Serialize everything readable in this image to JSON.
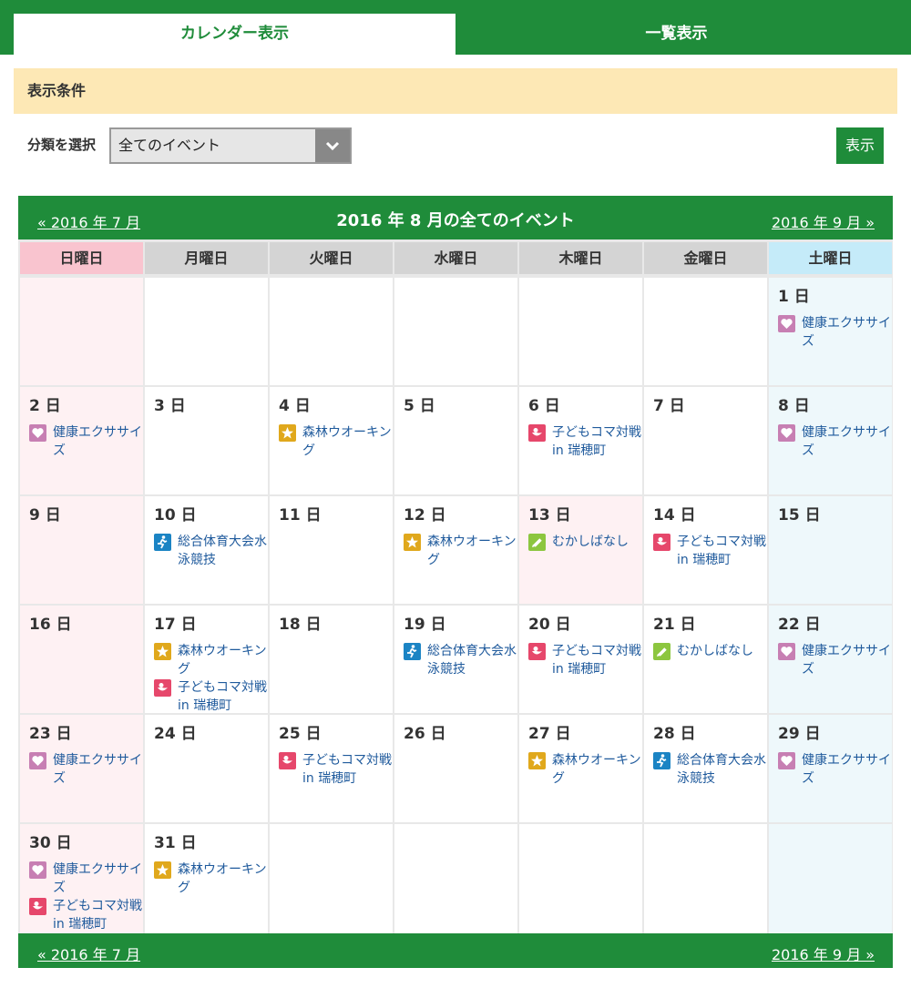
{
  "tabs": {
    "calendar": "カレンダー表示",
    "list": "一覧表示"
  },
  "conditions": {
    "header": "表示条件",
    "filter_label": "分類を選択",
    "select_value": "全てのイベント",
    "show_button": "表示"
  },
  "calendar": {
    "title": "2016 年 8 月の全てのイベント",
    "prev_link": "« 2016 年 7 月",
    "next_link": "2016 年 9 月 »",
    "weekdays": [
      "日曜日",
      "月曜日",
      "火曜日",
      "水曜日",
      "木曜日",
      "金曜日",
      "土曜日"
    ],
    "weeks": [
      [
        {
          "day": "",
          "events": []
        },
        {
          "day": "",
          "events": []
        },
        {
          "day": "",
          "events": []
        },
        {
          "day": "",
          "events": []
        },
        {
          "day": "",
          "events": []
        },
        {
          "day": "",
          "events": []
        },
        {
          "day": "1 日",
          "events": [
            {
              "icon": "heart-icon",
              "title": "健康エクササイズ"
            }
          ]
        }
      ],
      [
        {
          "day": "2 日",
          "events": [
            {
              "icon": "heart-icon",
              "title": "健康エクササイズ"
            }
          ]
        },
        {
          "day": "3 日",
          "events": []
        },
        {
          "day": "4 日",
          "events": [
            {
              "icon": "star-icon",
              "title": "森林ウオーキング"
            }
          ]
        },
        {
          "day": "5 日",
          "events": []
        },
        {
          "day": "6 日",
          "events": [
            {
              "icon": "bird-icon",
              "title": "子どもコマ対戦 in 瑞穂町"
            }
          ]
        },
        {
          "day": "7 日",
          "events": []
        },
        {
          "day": "8 日",
          "events": [
            {
              "icon": "heart-icon",
              "title": "健康エクササイズ"
            }
          ]
        }
      ],
      [
        {
          "day": "9 日",
          "events": []
        },
        {
          "day": "10 日",
          "events": [
            {
              "icon": "runner-icon",
              "title": "総合体育大会水泳競技"
            }
          ]
        },
        {
          "day": "11 日",
          "events": []
        },
        {
          "day": "12 日",
          "events": [
            {
              "icon": "star-icon",
              "title": "森林ウオーキング"
            }
          ]
        },
        {
          "day": "13 日",
          "holiday": true,
          "events": [
            {
              "icon": "pencil-icon",
              "title": "むかしばなし"
            }
          ]
        },
        {
          "day": "14 日",
          "events": [
            {
              "icon": "bird-icon",
              "title": "子どもコマ対戦 in 瑞穂町"
            }
          ]
        },
        {
          "day": "15 日",
          "events": []
        }
      ],
      [
        {
          "day": "16 日",
          "events": []
        },
        {
          "day": "17 日",
          "events": [
            {
              "icon": "star-icon",
              "title": "森林ウオーキング"
            },
            {
              "icon": "bird-icon",
              "title": "子どもコマ対戦 in 瑞穂町"
            }
          ]
        },
        {
          "day": "18 日",
          "events": []
        },
        {
          "day": "19 日",
          "events": [
            {
              "icon": "runner-icon",
              "title": "総合体育大会水泳競技"
            }
          ]
        },
        {
          "day": "20 日",
          "events": [
            {
              "icon": "bird-icon",
              "title": "子どもコマ対戦 in 瑞穂町"
            }
          ]
        },
        {
          "day": "21 日",
          "events": [
            {
              "icon": "pencil-icon",
              "title": "むかしばなし"
            }
          ]
        },
        {
          "day": "22 日",
          "events": [
            {
              "icon": "heart-icon",
              "title": "健康エクササイズ"
            }
          ]
        }
      ],
      [
        {
          "day": "23 日",
          "events": [
            {
              "icon": "heart-icon",
              "title": "健康エクササイズ"
            }
          ]
        },
        {
          "day": "24 日",
          "events": []
        },
        {
          "day": "25 日",
          "events": [
            {
              "icon": "bird-icon",
              "title": "子どもコマ対戦 in 瑞穂町"
            }
          ]
        },
        {
          "day": "26 日",
          "events": []
        },
        {
          "day": "27 日",
          "events": [
            {
              "icon": "star-icon",
              "title": "森林ウオーキング"
            }
          ]
        },
        {
          "day": "28 日",
          "events": [
            {
              "icon": "runner-icon",
              "title": "総合体育大会水泳競技"
            }
          ]
        },
        {
          "day": "29 日",
          "events": [
            {
              "icon": "heart-icon",
              "title": "健康エクササイズ"
            }
          ]
        }
      ],
      [
        {
          "day": "30 日",
          "events": [
            {
              "icon": "heart-icon",
              "title": "健康エクササイズ"
            },
            {
              "icon": "bird-icon",
              "title": "子どもコマ対戦 in 瑞穂町"
            }
          ]
        },
        {
          "day": "31 日",
          "events": [
            {
              "icon": "star-icon",
              "title": "森林ウオーキング"
            }
          ]
        },
        {
          "day": "",
          "events": []
        },
        {
          "day": "",
          "events": []
        },
        {
          "day": "",
          "events": []
        },
        {
          "day": "",
          "events": []
        },
        {
          "day": "",
          "events": []
        }
      ]
    ]
  },
  "colors": {
    "brand_green": "#1f8c3a",
    "link_blue": "#1f5a9c",
    "heart": "#c77fb3",
    "star": "#e0a81c",
    "bird": "#e6476b",
    "runner": "#1b84c4",
    "pencil": "#8cc63f"
  }
}
